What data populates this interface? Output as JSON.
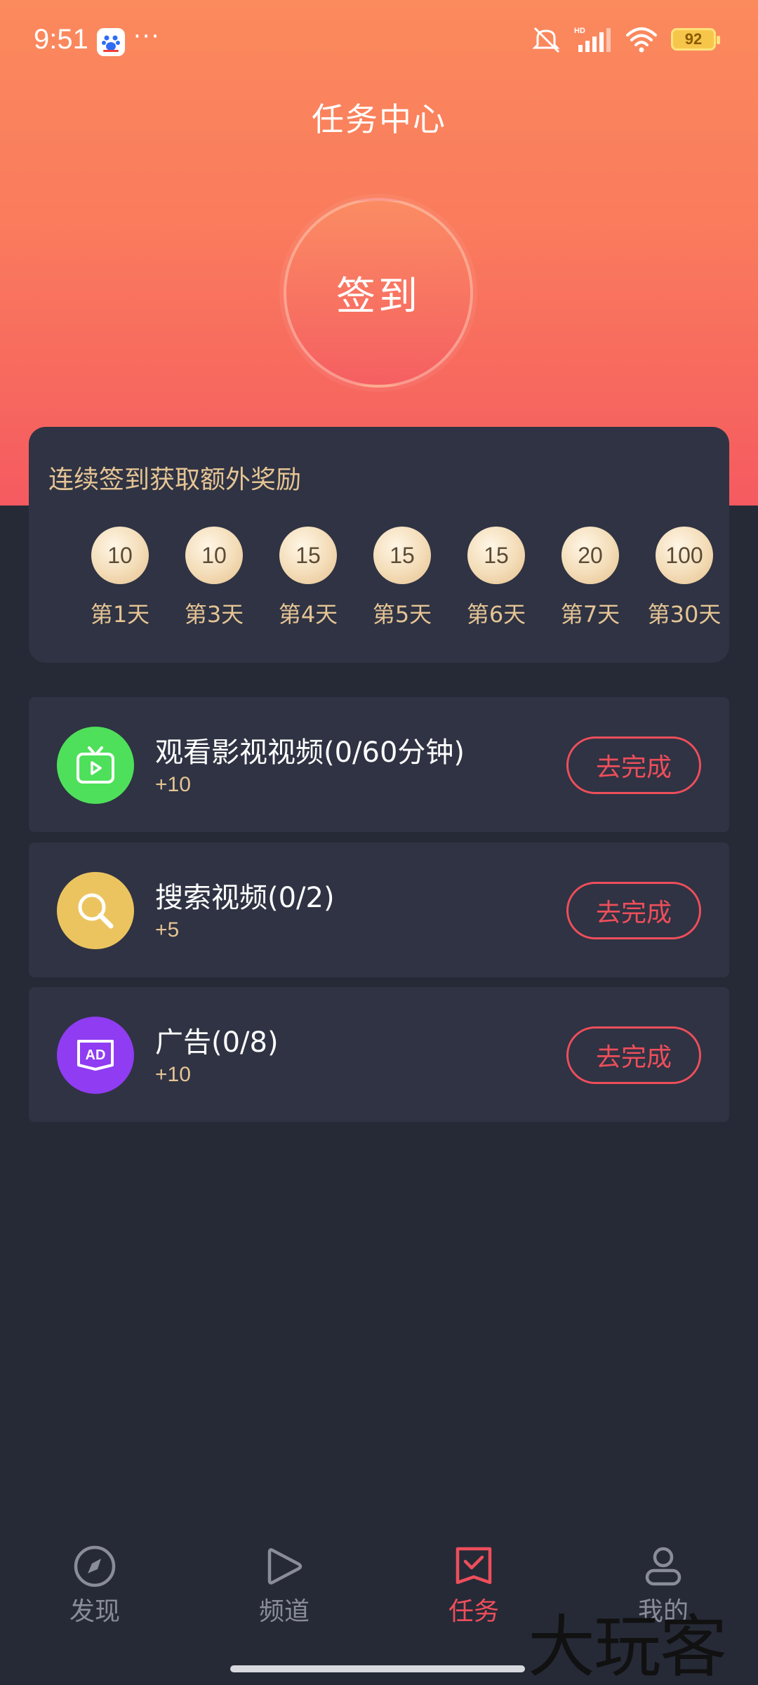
{
  "status_bar": {
    "time": "9:51",
    "more": "···",
    "battery": "92"
  },
  "header": {
    "title": "任务中心",
    "signin_label": "签到"
  },
  "streak": {
    "title": "连续签到获取额外奖励",
    "days": [
      {
        "value": "10",
        "label": "第1天"
      },
      {
        "value": "10",
        "label": "第3天"
      },
      {
        "value": "15",
        "label": "第4天"
      },
      {
        "value": "15",
        "label": "第5天"
      },
      {
        "value": "15",
        "label": "第6天"
      },
      {
        "value": "20",
        "label": "第7天"
      },
      {
        "value": "100",
        "label": "第30天"
      }
    ]
  },
  "tasks": [
    {
      "name": "观看影视视频(0/60分钟)",
      "reward": "+10",
      "button": "去完成",
      "icon": "tv-play-icon",
      "icon_color": "#4ee05a"
    },
    {
      "name": "搜索视频(0/2)",
      "reward": "+5",
      "button": "去完成",
      "icon": "search-icon",
      "icon_color": "#ecc45f"
    },
    {
      "name": "广告(0/8)",
      "reward": "+10",
      "button": "去完成",
      "icon": "ad-icon",
      "icon_color": "#8f3cf2"
    }
  ],
  "nav": [
    {
      "label": "发现",
      "icon": "compass-icon"
    },
    {
      "label": "频道",
      "icon": "play-icon"
    },
    {
      "label": "任务",
      "icon": "task-check-icon",
      "active": true
    },
    {
      "label": "我的",
      "icon": "user-icon"
    }
  ],
  "watermark": "大玩客",
  "colors": {
    "accent": "#ee4e5b",
    "gold_text": "#e5c494",
    "background": "#262a37",
    "card": "#2f3343"
  }
}
